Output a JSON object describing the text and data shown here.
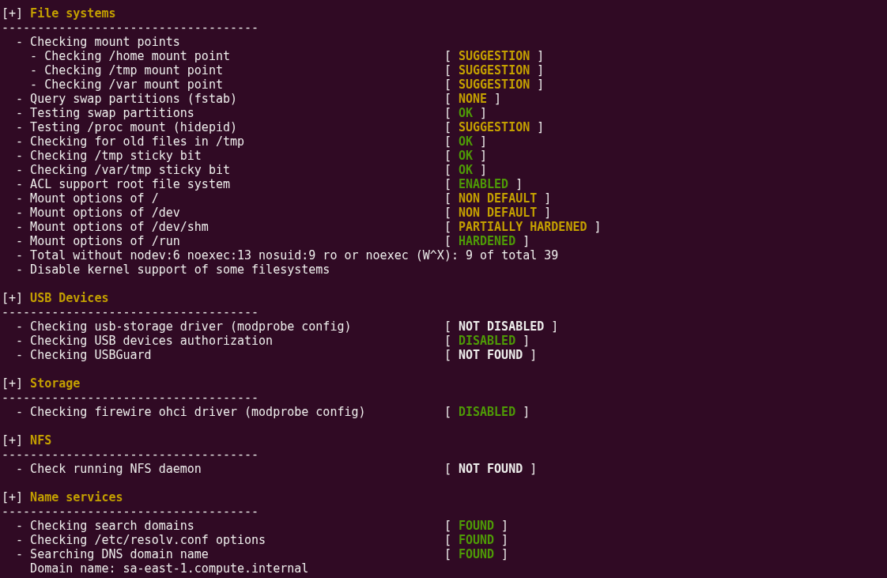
{
  "sections": [
    {
      "marker": "[+]",
      "title": "File systems",
      "rule": "------------------------------------",
      "items": [
        {
          "text": "- Checking mount points",
          "children": [
            {
              "text": "- Checking /home mount point",
              "open": "[",
              "status": "SUGGESTION",
              "close": "]",
              "color": "#c4a000"
            },
            {
              "text": "- Checking /tmp mount point",
              "open": "[",
              "status": "SUGGESTION",
              "close": "]",
              "color": "#c4a000"
            },
            {
              "text": "- Checking /var mount point",
              "open": "[",
              "status": "SUGGESTION",
              "close": "]",
              "color": "#c4a000"
            }
          ]
        },
        {
          "text": "- Query swap partitions (fstab)",
          "open": "[",
          "status": "NONE",
          "close": "]",
          "color": "#c4a000"
        },
        {
          "text": "- Testing swap partitions",
          "open": "[",
          "status": "OK",
          "close": "]",
          "color": "#4e9a06"
        },
        {
          "text": "- Testing /proc mount (hidepid)",
          "open": "[",
          "status": "SUGGESTION",
          "close": "]",
          "color": "#c4a000"
        },
        {
          "text": "- Checking for old files in /tmp",
          "open": "[",
          "status": "OK",
          "close": "]",
          "color": "#4e9a06"
        },
        {
          "text": "- Checking /tmp sticky bit",
          "open": "[",
          "status": "OK",
          "close": "]",
          "color": "#4e9a06"
        },
        {
          "text": "- Checking /var/tmp sticky bit",
          "open": "[",
          "status": "OK",
          "close": "]",
          "color": "#4e9a06"
        },
        {
          "text": "- ACL support root file system",
          "open": "[",
          "status": "ENABLED",
          "close": "]",
          "color": "#4e9a06"
        },
        {
          "text": "- Mount options of /",
          "open": "[",
          "status": "NON DEFAULT",
          "close": "]",
          "color": "#c4a000"
        },
        {
          "text": "- Mount options of /dev",
          "open": "[",
          "status": "NON DEFAULT",
          "close": "]",
          "color": "#c4a000"
        },
        {
          "text": "- Mount options of /dev/shm",
          "open": "[",
          "status": "PARTIALLY HARDENED",
          "close": "]",
          "color": "#c4a000"
        },
        {
          "text": "- Mount options of /run",
          "open": "[",
          "status": "HARDENED",
          "close": "]",
          "color": "#4e9a06"
        },
        {
          "text": "- Total without nodev:6 noexec:13 nosuid:9 ro or noexec (W^X): 9 of total 39"
        },
        {
          "text": "- Disable kernel support of some filesystems"
        }
      ]
    },
    {
      "marker": "[+]",
      "title": "USB Devices",
      "rule": "------------------------------------",
      "items": [
        {
          "text": "- Checking usb-storage driver (modprobe config)",
          "open": "[",
          "status": "NOT DISABLED",
          "close": "]",
          "color": "#eeeeec"
        },
        {
          "text": "- Checking USB devices authorization",
          "open": "[",
          "status": "DISABLED",
          "close": "]",
          "color": "#4e9a06"
        },
        {
          "text": "- Checking USBGuard",
          "open": "[",
          "status": "NOT FOUND",
          "close": "]",
          "color": "#eeeeec"
        }
      ]
    },
    {
      "marker": "[+]",
      "title": "Storage",
      "rule": "------------------------------------",
      "items": [
        {
          "text": "- Checking firewire ohci driver (modprobe config)",
          "open": "[",
          "status": "DISABLED",
          "close": "]",
          "color": "#4e9a06"
        }
      ]
    },
    {
      "marker": "[+]",
      "title": "NFS",
      "rule": "------------------------------------",
      "items": [
        {
          "text": "- Check running NFS daemon",
          "open": "[",
          "status": "NOT FOUND",
          "close": "]",
          "color": "#eeeeec"
        }
      ]
    },
    {
      "marker": "[+]",
      "title": "Name services",
      "rule": "------------------------------------",
      "items": [
        {
          "text": "- Checking search domains",
          "open": "[",
          "status": "FOUND",
          "close": "]",
          "color": "#4e9a06"
        },
        {
          "text": "- Checking /etc/resolv.conf options",
          "open": "[",
          "status": "FOUND",
          "close": "]",
          "color": "#4e9a06"
        },
        {
          "text": "- Searching DNS domain name",
          "open": "[",
          "status": "FOUND",
          "close": "]",
          "color": "#4e9a06",
          "children": [
            {
              "text": "Domain name: sa-east-1.compute.internal"
            }
          ]
        }
      ]
    }
  ]
}
